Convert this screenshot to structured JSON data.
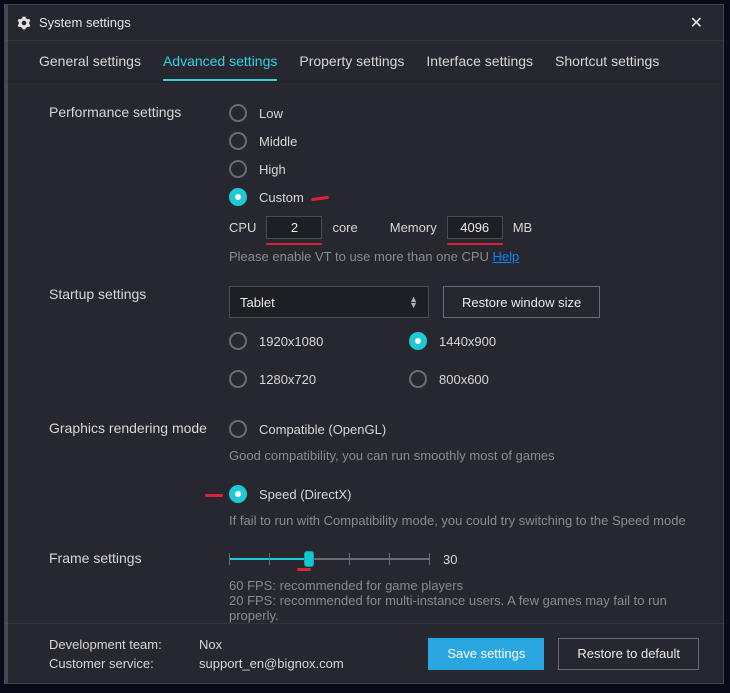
{
  "window": {
    "title": "System settings"
  },
  "tabs": {
    "general": "General settings",
    "advanced": "Advanced settings",
    "property": "Property settings",
    "interface": "Interface settings",
    "shortcut": "Shortcut settings"
  },
  "perf": {
    "heading": "Performance settings",
    "low": "Low",
    "middle": "Middle",
    "high": "High",
    "custom": "Custom",
    "cpu_label": "CPU",
    "cpu_value": "2",
    "core_label": "core",
    "mem_label": "Memory",
    "mem_value": "4096",
    "mb_label": "MB",
    "vt_hint": "Please enable VT to use more than one CPU",
    "help": "Help"
  },
  "startup": {
    "heading": "Startup settings",
    "select_value": "Tablet",
    "restore_btn": "Restore window size",
    "r1": "1920x1080",
    "r2": "1440x900",
    "r3": "1280x720",
    "r4": "800x600"
  },
  "gfx": {
    "heading": "Graphics rendering mode",
    "opt1": "Compatible (OpenGL)",
    "note1": "Good compatibility, you can run smoothly most of games",
    "opt2": "Speed (DirectX)",
    "note2": "If fail to run with Compatibility mode, you could try switching to the Speed mode"
  },
  "frame": {
    "heading": "Frame settings",
    "value": "30",
    "note": "60 FPS: recommended for game players\n20 FPS: recommended for multi-instance users. A few games may fail to run properly."
  },
  "footer": {
    "dev_k": "Development team:",
    "dev_v": "Nox",
    "cs_k": "Customer service:",
    "cs_v": "support_en@bignox.com",
    "save": "Save settings",
    "restore": "Restore to default"
  }
}
